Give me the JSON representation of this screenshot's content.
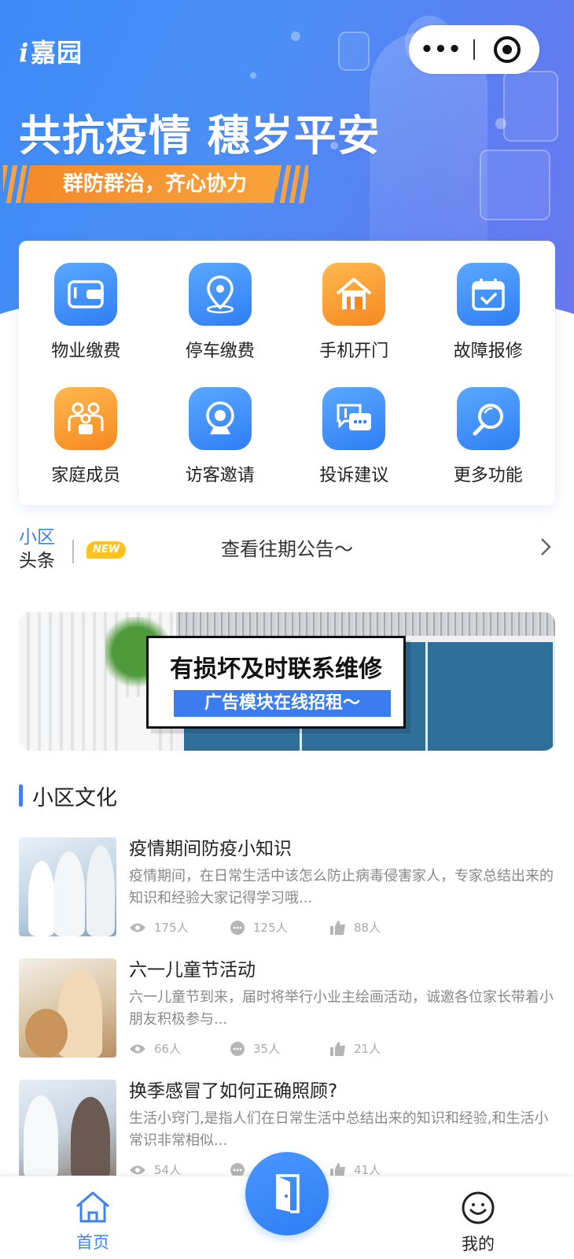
{
  "app": {
    "logo_prefix": "i",
    "logo_text": "嘉园"
  },
  "capsule": {
    "more_label": "•••"
  },
  "hero": {
    "title": "共抗疫情  穗岁平安",
    "slogan": "群防群治，齐心协力"
  },
  "menu": {
    "items": [
      {
        "label": "物业缴费",
        "icon": "wallet-icon",
        "color": "blue"
      },
      {
        "label": "停车缴费",
        "icon": "location-pin-icon",
        "color": "blue"
      },
      {
        "label": "手机开门",
        "icon": "house-icon",
        "color": "orange"
      },
      {
        "label": "故障报修",
        "icon": "calendar-check-icon",
        "color": "blue"
      },
      {
        "label": "家庭成员",
        "icon": "family-icon",
        "color": "orange"
      },
      {
        "label": "访客邀请",
        "icon": "camera-icon",
        "color": "blue"
      },
      {
        "label": "投诉建议",
        "icon": "chat-bubble-icon",
        "color": "blue"
      },
      {
        "label": "更多功能",
        "icon": "search-icon",
        "color": "blue"
      }
    ]
  },
  "notice": {
    "tag_line1": "小区",
    "tag_line2": "头条",
    "badge": "NEW",
    "text": "查看往期公告～"
  },
  "ad": {
    "title": "有损坏及时联系维修",
    "subtitle": "广告模块在线招租～"
  },
  "culture": {
    "section_title": "小区文化",
    "articles": [
      {
        "title": "疫情期间防疫小知识",
        "desc": "疫情期间，在日常生活中该怎么防止病毒侵害家人，专家总结出来的知识和经验大家记得学习哦...",
        "views": "175人",
        "comments": "125人",
        "likes": "88人"
      },
      {
        "title": "六一儿童节活动",
        "desc": "六一儿童节到来，届时将举行小业主绘画活动，诚邀各位家长带着小朋友积极参与...",
        "views": "66人",
        "comments": "35人",
        "likes": "21人"
      },
      {
        "title": "换季感冒了如何正确照顾?",
        "desc": " 生活小窍门,是指人们在日常生活中总结出来的知识和经验,和生活小常识非常相似...",
        "views": "54人",
        "comments": "",
        "likes": "41人"
      }
    ]
  },
  "tabbar": {
    "home_label": "首页",
    "mine_label": "我的"
  },
  "colors": {
    "accent": "#3d82f0",
    "orange": "#f6891f",
    "badge": "#ffc21a"
  }
}
